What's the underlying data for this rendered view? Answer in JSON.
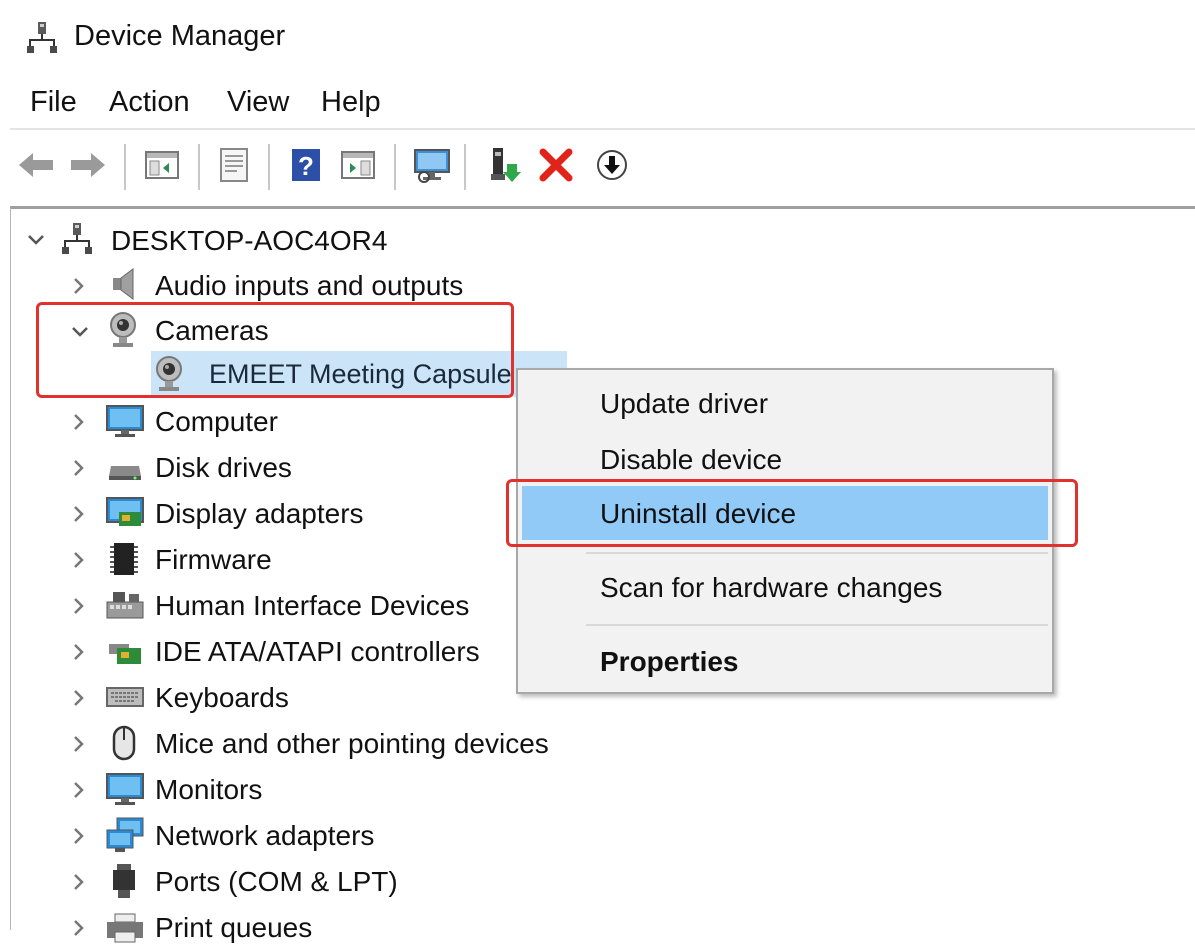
{
  "window": {
    "title": "Device Manager"
  },
  "menu": [
    "File",
    "Action",
    "View",
    "Help"
  ],
  "toolbar": [
    "back-icon",
    "forward-icon",
    "show-hide-console-tree-icon",
    "properties-icon",
    "help-icon",
    "action-pane-icon",
    "scan-hardware-icon",
    "update-driver-icon",
    "uninstall-icon",
    "enable-device-icon"
  ],
  "tree": {
    "root": "DESKTOP-AOC4OR4",
    "items": [
      {
        "label": "Audio inputs and outputs",
        "icon": "speaker-icon",
        "expanded": false
      },
      {
        "label": "Cameras",
        "icon": "webcam-icon",
        "expanded": true
      },
      {
        "label": "EMEET Meeting Capsule",
        "icon": "webcam-icon",
        "child": true,
        "selected": true
      },
      {
        "label": "Computer",
        "icon": "computer-icon",
        "expanded": false
      },
      {
        "label": "Disk drives",
        "icon": "disk-drive-icon",
        "expanded": false
      },
      {
        "label": "Display adapters",
        "icon": "display-adapter-icon",
        "expanded": false
      },
      {
        "label": "Firmware",
        "icon": "firmware-icon",
        "expanded": false
      },
      {
        "label": "Human Interface Devices",
        "icon": "hid-icon",
        "expanded": false
      },
      {
        "label": "IDE ATA/ATAPI controllers",
        "icon": "ide-controller-icon",
        "expanded": false
      },
      {
        "label": "Keyboards",
        "icon": "keyboard-icon",
        "expanded": false
      },
      {
        "label": "Mice and other pointing devices",
        "icon": "mouse-icon",
        "expanded": false
      },
      {
        "label": "Monitors",
        "icon": "monitor-icon",
        "expanded": false
      },
      {
        "label": "Network adapters",
        "icon": "network-adapter-icon",
        "expanded": false
      },
      {
        "label": "Ports (COM & LPT)",
        "icon": "port-icon",
        "expanded": false
      },
      {
        "label": "Print queues",
        "icon": "printer-icon",
        "expanded": false
      }
    ]
  },
  "context_menu": {
    "items": [
      "Update driver",
      "Disable device",
      "Uninstall device",
      "Scan for hardware changes",
      "Properties"
    ],
    "highlighted": "Uninstall device",
    "default_bold": "Properties"
  },
  "colors": {
    "highlight_box": "#e0312d",
    "selection": "#cce4f7",
    "menu_hover": "#91c9f7"
  }
}
